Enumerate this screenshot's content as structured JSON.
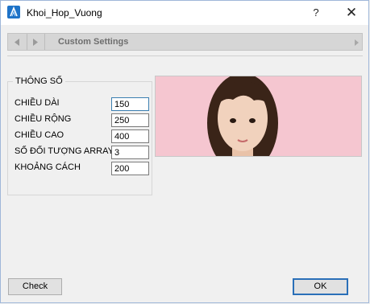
{
  "window": {
    "title": "Khoi_Hop_Vuong",
    "help_label": "?",
    "close_label": "✕"
  },
  "navbar": {
    "title": "Custom Settings"
  },
  "params": {
    "group_title": "THÔNG SỐ",
    "fields": [
      {
        "label": "CHIỀU DÀI",
        "value": "150"
      },
      {
        "label": "CHIỀU RỘNG",
        "value": "250"
      },
      {
        "label": "CHIỀU CAO",
        "value": "400"
      },
      {
        "label": "SỐ ĐỐI TƯỢNG ARRAY",
        "value": "3"
      },
      {
        "label": "KHOẢNG CÁCH",
        "value": "200"
      }
    ]
  },
  "buttons": {
    "check_label": "Check",
    "ok_label": "OK"
  },
  "colors": {
    "accent": "#2a6fb8",
    "image_background": "#f5c6d0"
  }
}
